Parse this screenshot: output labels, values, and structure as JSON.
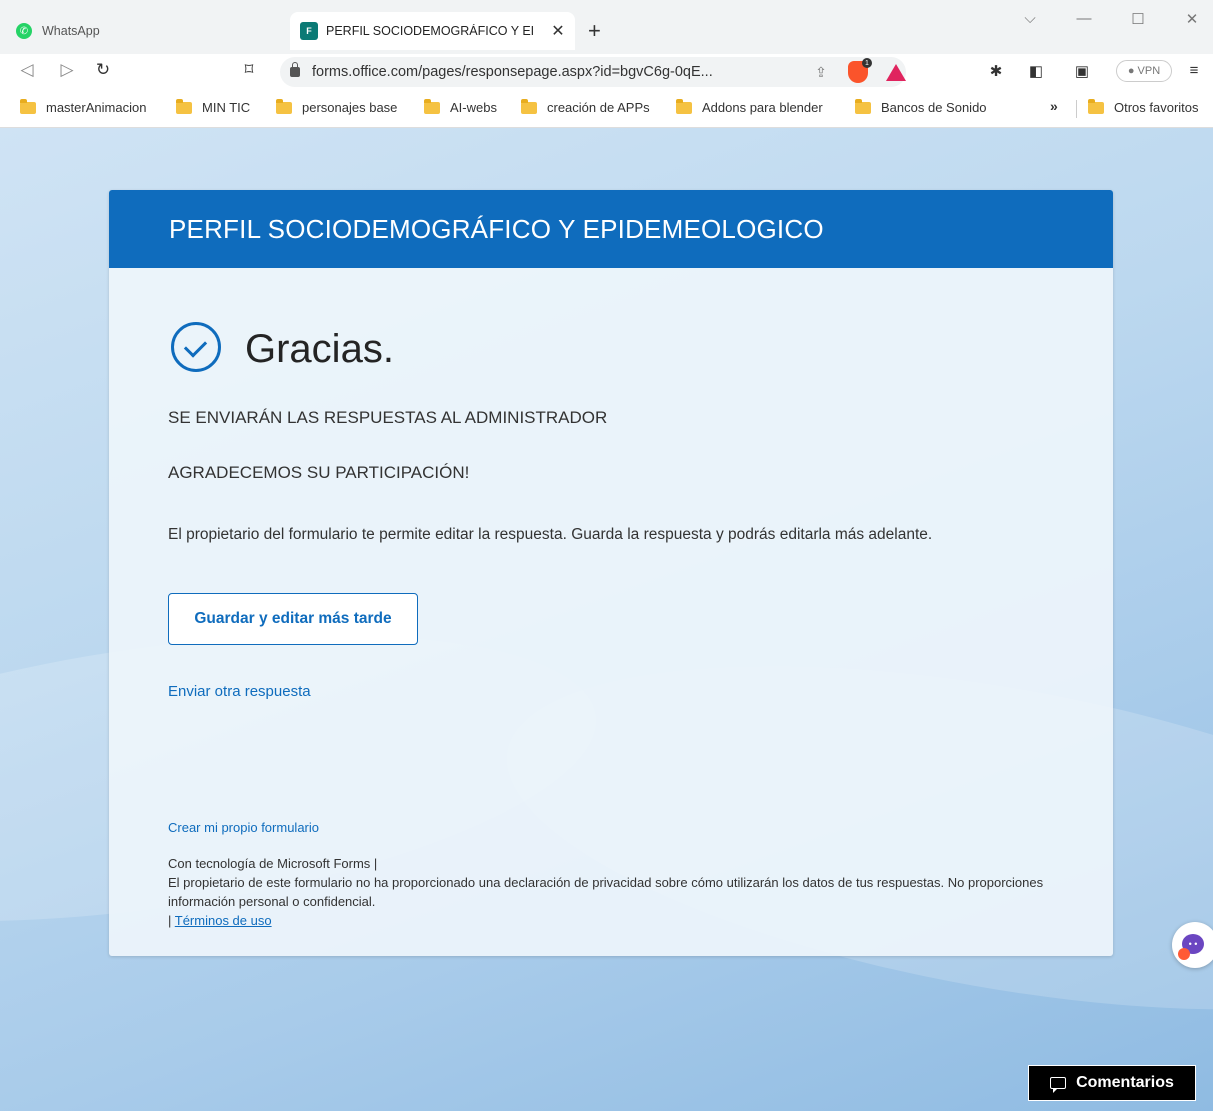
{
  "browser": {
    "tabs": [
      {
        "title": "WhatsApp",
        "active": false
      },
      {
        "title": "PERFIL SOCIODEMOGRÁFICO Y EI",
        "active": true
      }
    ],
    "url": "forms.office.com/pages/responsepage.aspx?id=bgvC6g-0qE...",
    "brave_badge": "1",
    "vpn_label": "● VPN",
    "bookmarks": [
      "masterAnimacion",
      "MIN TIC",
      "personajes base",
      "AI-webs",
      "creación de APPs",
      "Addons para blender",
      "Bancos de Sonido"
    ],
    "bookmarks_more": "»",
    "other_bookmarks": "Otros favoritos"
  },
  "form": {
    "title": "PERFIL SOCIODEMOGRÁFICO Y EPIDEMEOLOGICO",
    "thanks": "Gracias.",
    "line1": "SE ENVIARÁN LAS RESPUESTAS AL ADMINISTRADOR",
    "line2": "AGRADECEMOS SU PARTICIPACIÓN!",
    "edit_note": "El propietario del formulario te permite editar la respuesta. Guarda la respuesta y podrás editarla más adelante.",
    "save_button": "Guardar y editar más tarde",
    "another_response": "Enviar otra respuesta",
    "create_own": "Crear mi propio formulario",
    "powered_by": "Con tecnología de Microsoft Forms |",
    "privacy_note": "El propietario de este formulario no ha proporcionado una declaración de privacidad sobre cómo utilizarán los datos de tus respuestas. No proporciones información personal o confidencial.",
    "terms_prefix": "| ",
    "terms": "Términos de uso"
  },
  "feedback_button": "Comentarios",
  "colors": {
    "accent": "#0f6cbd",
    "header_bg": "#0f6cbd"
  }
}
